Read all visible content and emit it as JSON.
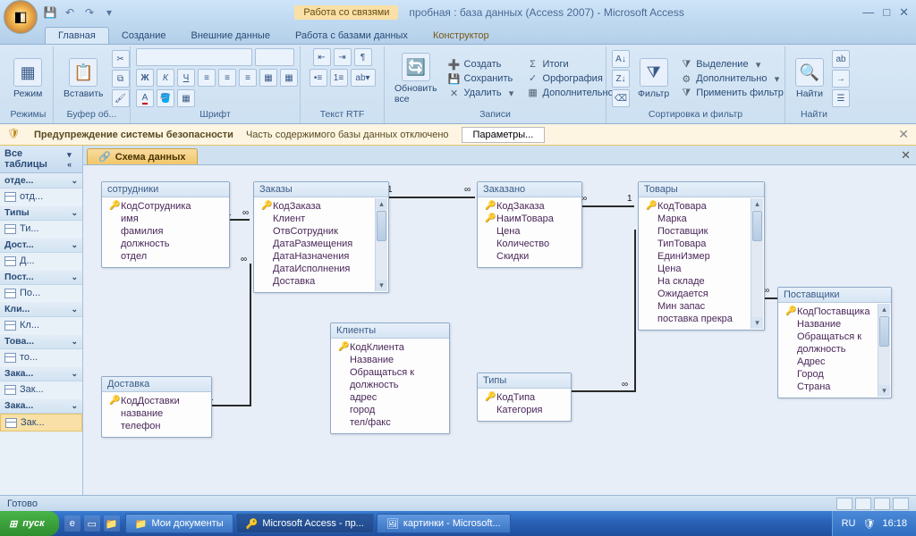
{
  "title": {
    "context_tab": "Работа со связями",
    "text": "пробная : база данных (Access 2007) - Microsoft Access"
  },
  "ribbon": {
    "tabs": [
      "Главная",
      "Создание",
      "Внешние данные",
      "Работа с базами данных",
      "Конструктор"
    ],
    "groups": {
      "modes": "Режимы",
      "mode_btn": "Режим",
      "clipboard": "Буфер об...",
      "paste": "Вставить",
      "font": "Шрифт",
      "rtf": "Текст RTF",
      "records": "Записи",
      "refresh": "Обновить\nвсе",
      "new": "Создать",
      "save": "Сохранить",
      "delete": "Удалить",
      "totals": "Итоги",
      "spelling": "Орфография",
      "more": "Дополнительно",
      "sort": "Сортировка и фильтр",
      "filter": "Фильтр",
      "selection": "Выделение",
      "advanced": "Дополнительно",
      "toggle": "Применить фильтр",
      "find_grp": "Найти",
      "find": "Найти"
    }
  },
  "security": {
    "title": "Предупреждение системы безопасности",
    "msg": "Часть содержимого базы данных отключено",
    "btn": "Параметры..."
  },
  "nav": {
    "header": "Все таблицы",
    "groups": [
      {
        "h": "отде...",
        "items": [
          "отд..."
        ]
      },
      {
        "h": "Типы",
        "items": [
          "Ти..."
        ]
      },
      {
        "h": "Дост...",
        "items": [
          "Д..."
        ]
      },
      {
        "h": "Пост...",
        "items": [
          "По..."
        ]
      },
      {
        "h": "Кли...",
        "items": [
          "Кл..."
        ]
      },
      {
        "h": "Това...",
        "items": [
          "то..."
        ]
      },
      {
        "h": "Зака...",
        "items": [
          "Зак..."
        ]
      },
      {
        "h": "Зака...",
        "items": [
          "Зак..."
        ]
      }
    ]
  },
  "doc": {
    "tab": "Схема данных"
  },
  "tables": {
    "sotr": {
      "title": "сотрудники",
      "fields": [
        "КодСотрудника",
        "имя",
        "фамилия",
        "должность",
        "отдел"
      ],
      "keys": [
        0
      ]
    },
    "zakazy": {
      "title": "Заказы",
      "fields": [
        "КодЗаказа",
        "Клиент",
        "ОтвСотрудник",
        "ДатаРазмещения",
        "ДатаНазначения",
        "ДатаИсполнения",
        "Доставка"
      ],
      "keys": [
        0
      ]
    },
    "zakazano": {
      "title": "Заказано",
      "fields": [
        "КодЗаказа",
        "НаимТовара",
        "Цена",
        "Количество",
        "Скидки"
      ],
      "keys": [
        0,
        1
      ]
    },
    "tovary": {
      "title": "Товары",
      "fields": [
        "КодТовара",
        "Марка",
        "Поставщик",
        "ТипТовара",
        "ЕдинИзмер",
        "Цена",
        "На складе",
        "Ожидается",
        "Мин запас",
        "поставка прекра"
      ],
      "keys": [
        0
      ]
    },
    "postav": {
      "title": "Поставщики",
      "fields": [
        "КодПоставщика",
        "Название",
        "Обращаться к",
        "должность",
        "Адрес",
        "Город",
        "Страна"
      ],
      "keys": [
        0
      ]
    },
    "klienty": {
      "title": "Клиенты",
      "fields": [
        "КодКлиента",
        "Название",
        "Обращаться к",
        "должность",
        "адрес",
        "город",
        "тел/факс"
      ],
      "keys": [
        0
      ]
    },
    "dostavka": {
      "title": "Доставка",
      "fields": [
        "КодДоставки",
        "название",
        "телефон"
      ],
      "keys": [
        0
      ]
    },
    "tipy": {
      "title": "Типы",
      "fields": [
        "КодТипа",
        "Категория"
      ],
      "keys": [
        0
      ]
    }
  },
  "status": "Готово",
  "taskbar": {
    "start": "пуск",
    "items": [
      "Мои документы",
      "Microsoft Access - пр...",
      "картинки - Microsoft..."
    ],
    "lang": "RU",
    "time": "16:18"
  }
}
